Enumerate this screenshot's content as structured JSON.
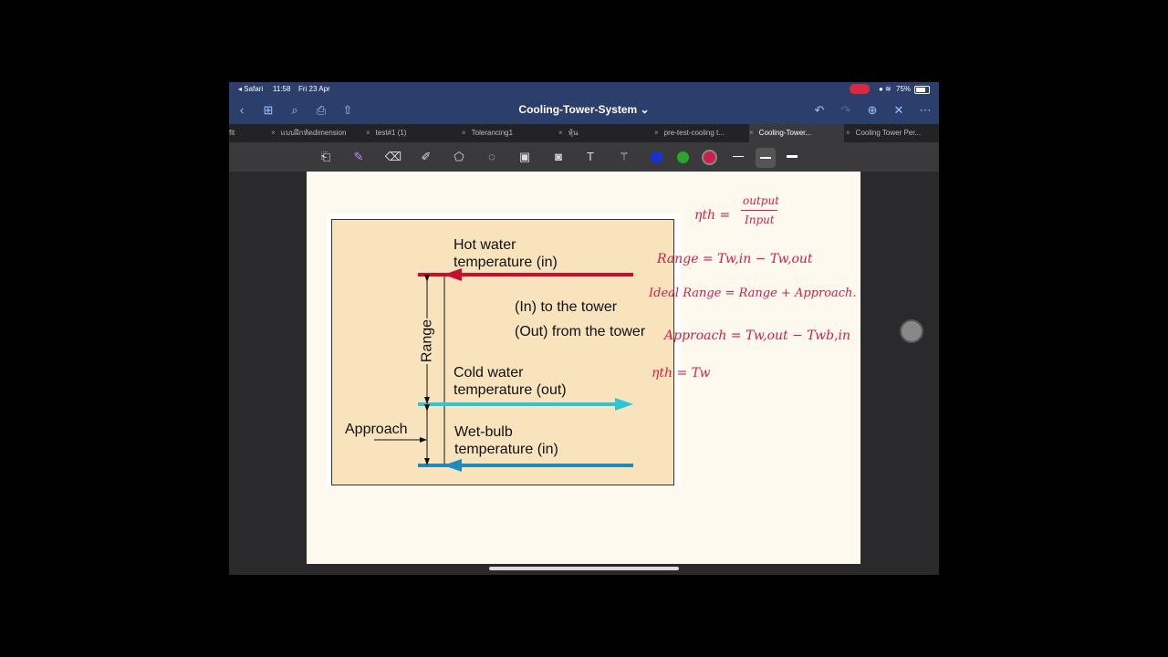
{
  "status": {
    "back_app": "◂ Safari",
    "time": "11:58",
    "date": "Fri 23 Apr",
    "battery": "75%"
  },
  "nav": {
    "title": "Cooling-Tower-System ⌄"
  },
  "tabs": [
    {
      "label": "fit"
    },
    {
      "label": "แบบฝึกหัดdimension"
    },
    {
      "label": "test#1 (1)"
    },
    {
      "label": "Tolerancing1"
    },
    {
      "label": "หุ้น"
    },
    {
      "label": "pre-test-cooling t..."
    },
    {
      "label": "Cooling-Tower..."
    },
    {
      "label": "Cooling Tower Per..."
    }
  ],
  "colors": {
    "accent": "#2c3e6b",
    "pen_blue": "#1b2fd6",
    "pen_green": "#2aa72a",
    "pen_red": "#d01f4a",
    "hot_line": "#c8102e",
    "cold_line": "#2ec6d3",
    "wet_line": "#1e8bbd",
    "figure_bg": "#f9e3bd"
  },
  "figure": {
    "hot_water": [
      "Hot water",
      "temperature (in)"
    ],
    "in_to_tower": "(In) to the tower",
    "out_from_tower": "(Out) from the tower",
    "range": "Range",
    "cold_water": [
      "Cold water",
      "temperature (out)"
    ],
    "approach": "Approach",
    "wet_bulb": [
      "Wet-bulb",
      "temperature (in)"
    ]
  },
  "notes": {
    "eta_lhs": "ηth =",
    "eta_num": "output",
    "eta_den": "Input",
    "range_eq": "Range = Tw,in − Tw,out",
    "ideal_range_eq": "Ideal Range = Range + Approach.",
    "approach_eq": "Approach = Tw,out − Twb,in",
    "eta2": "ηth =  Tw"
  }
}
